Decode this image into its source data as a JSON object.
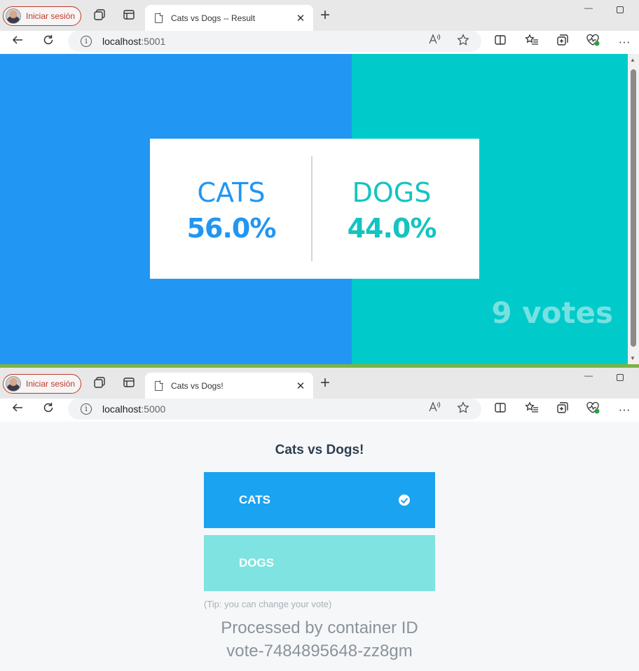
{
  "browser": {
    "profile_label": "Iniciar sesión",
    "minimize_glyph": "—",
    "new_tab_glyph": "+",
    "close_glyph": "✕"
  },
  "result_window": {
    "tab_title": "Cats vs Dogs -- Result",
    "url_host": "localhost",
    "url_port": ":5001",
    "cats_label": "CATS",
    "cats_percent": "56.0%",
    "dogs_label": "DOGS",
    "dogs_percent": "44.0%",
    "votes_text": "9 votes",
    "cats_share": 0.56,
    "colors": {
      "cats": "#2196f3",
      "dogs": "#00cbca"
    }
  },
  "vote_window": {
    "tab_title": "Cats vs Dogs!",
    "url_host": "localhost",
    "url_port": ":5000",
    "heading": "Cats vs Dogs!",
    "option_a": "CATS",
    "option_b": "DOGS",
    "selected": "CATS",
    "tip": "(Tip: you can change your vote)",
    "processed_line1": "Processed by container ID",
    "processed_line2": "vote-7484895648-zz8gm",
    "colors": {
      "cats_button": "#1aa3f0",
      "dogs_button": "#7ee3e1"
    }
  }
}
